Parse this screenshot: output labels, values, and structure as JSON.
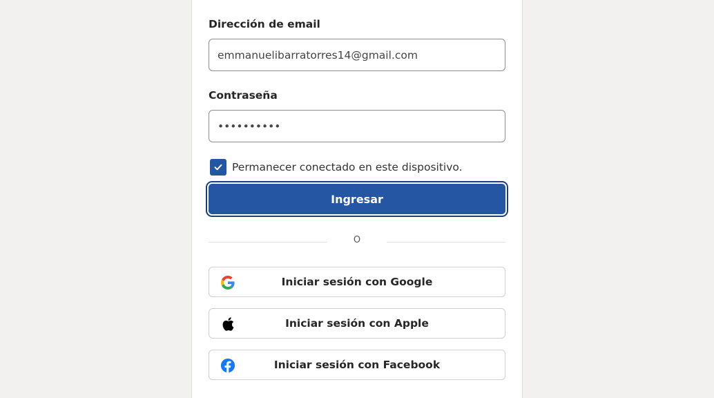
{
  "form": {
    "email_label": "Dirección de email",
    "email_value": "emmanuelibarratorres14@gmail.com",
    "password_label": "Contraseña",
    "password_value": "••••••••••",
    "remember_label": "Permanecer conectado en este dispositivo.",
    "remember_checked": true,
    "submit_label": "Ingresar"
  },
  "divider": {
    "text": "O"
  },
  "social": [
    {
      "label": "Iniciar sesión con Google",
      "icon": "google-icon"
    },
    {
      "label": "Iniciar sesión con Apple",
      "icon": "apple-icon"
    },
    {
      "label": "Iniciar sesión con Facebook",
      "icon": "facebook-icon"
    }
  ],
  "colors": {
    "primary": "#2456a4",
    "background": "#f2f1ef",
    "facebook": "#1877f2"
  }
}
